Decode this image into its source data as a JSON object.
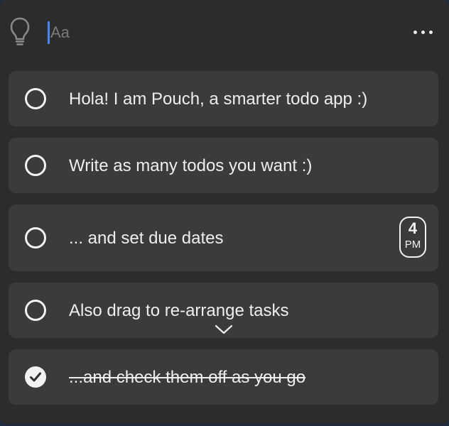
{
  "app": {
    "name": "Pouch"
  },
  "header": {
    "input_value": "",
    "input_placeholder": "Aa",
    "bulb_icon": "lightbulb-icon",
    "more_icon": "ellipsis-icon"
  },
  "tasks": [
    {
      "label": "Hola! I am Pouch, a smarter todo app :)",
      "completed": false
    },
    {
      "label": "Write as many todos you want :)",
      "completed": false
    },
    {
      "label": "... and set due dates",
      "completed": false,
      "due": {
        "hour": "4",
        "meridiem": "PM"
      }
    },
    {
      "label": "Also drag to re-arrange tasks",
      "completed": false
    },
    {
      "label": "...and check them off as you go",
      "completed": true
    }
  ],
  "colors": {
    "window_bg": "#2c2c2c",
    "card_bg": "#3b3b3b",
    "text": "#eeeeee",
    "caret": "#4a86f0",
    "desktop": "#1f2b3c"
  }
}
